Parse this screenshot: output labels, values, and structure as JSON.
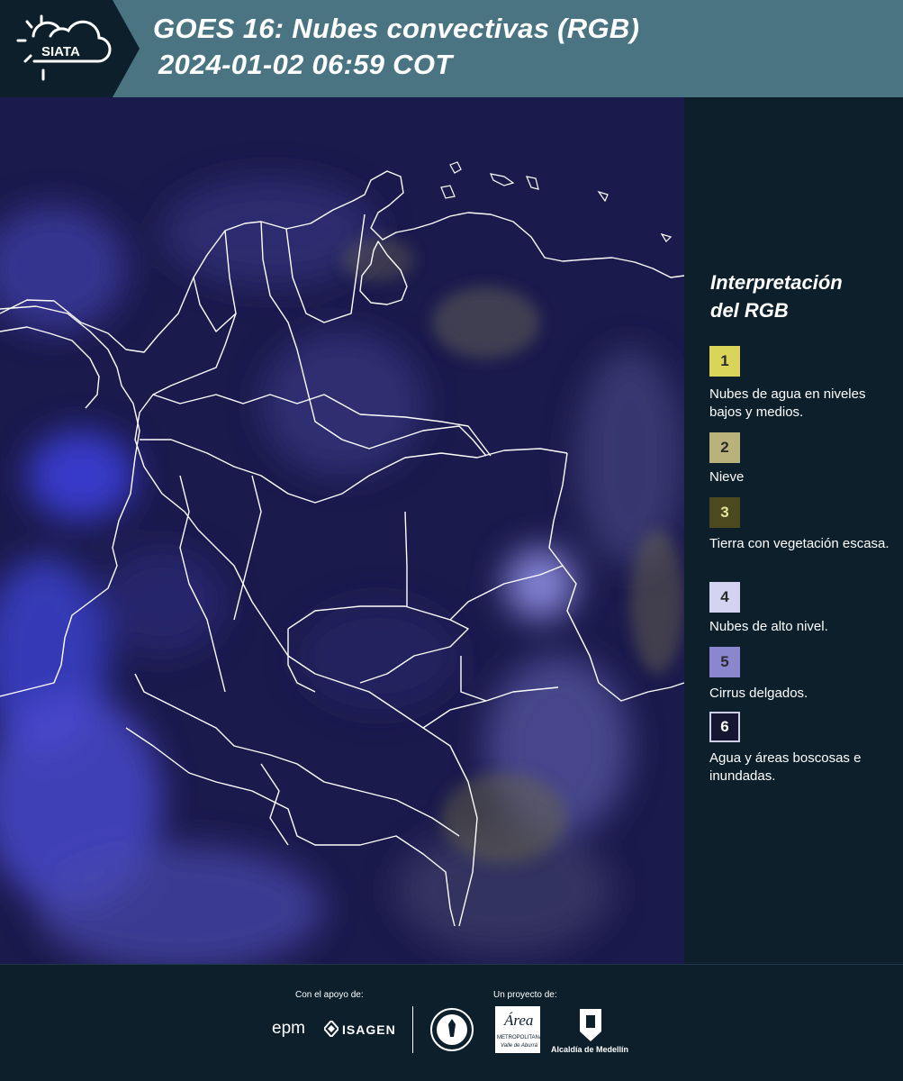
{
  "header": {
    "logo_text": "SIATA",
    "title_line1": "GOES 16: Nubes convectivas (RGB)",
    "title_line2": "2024-01-02 06:59 COT"
  },
  "legend": {
    "title_line1": "Interpretación",
    "title_line2": "del RGB",
    "items": [
      {
        "number": "1",
        "color": "#d9d45a",
        "label": "Nubes de agua en niveles bajos y medios."
      },
      {
        "number": "2",
        "color": "#b9b27a",
        "label": "Nieve"
      },
      {
        "number": "3",
        "color": "#4a4a1e",
        "label": "Tierra con vegetación escasa."
      },
      {
        "number": "4",
        "color": "#d5d3f2",
        "label": "Nubes de alto nivel."
      },
      {
        "number": "5",
        "color": "#8b87cf",
        "label": "Cirrus delgados."
      },
      {
        "number": "6",
        "color": "#161632",
        "label": "Agua y áreas boscosas e inundadas."
      }
    ]
  },
  "footer": {
    "support_label": "Con el apoyo de:",
    "project_label": "Un proyecto de:",
    "sponsor_epm": "epm",
    "sponsor_isagen": "ISAGEN",
    "partner_area": "Área",
    "partner_area_sub": "METROPOLITANA",
    "partner_area_sub2": "Valle de Aburrá",
    "partner_alcaldia": "Alcaldía de Medellín"
  },
  "colors": {
    "header_bg": "#4a7482",
    "panel_bg": "#0c1f2b",
    "map_base": "#1a1a4c",
    "border_lines": "#ffffff"
  }
}
